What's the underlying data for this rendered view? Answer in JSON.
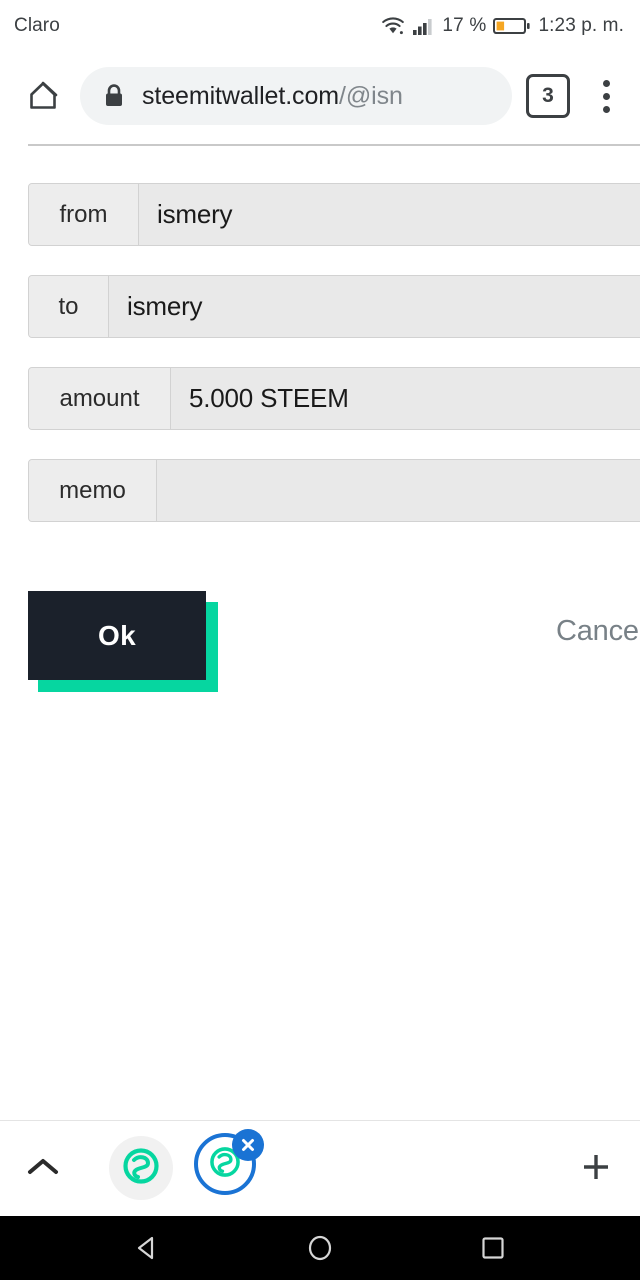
{
  "status_bar": {
    "carrier": "Claro",
    "battery_percent": "17 %",
    "time": "1:23 p. m.",
    "icons": {
      "wifi": "wifi-icon",
      "signal": "cellular-signal-icon",
      "battery": "battery-low-icon"
    },
    "battery_fill_color": "#f5a623",
    "text_color": "#3c4043"
  },
  "browser": {
    "home_icon": "home-icon",
    "lock_icon": "lock-icon",
    "url_domain": "steemitwallet.com",
    "url_path": "/@isn",
    "tab_count": "3",
    "overflow_icon": "more-vertical-icon",
    "url_pill_color": "#f1f3f4"
  },
  "form": {
    "rows": [
      {
        "label": "from",
        "value": "ismery",
        "label_width": 110
      },
      {
        "label": "to",
        "value": "ismery",
        "label_width": 80
      },
      {
        "label": "amount",
        "value": "5.000 STEEM",
        "label_width": 142
      },
      {
        "label": "memo",
        "value": "",
        "label_width": 128
      }
    ],
    "field_bg": "#e9e9e9",
    "label_bg": "#ededed",
    "border_color": "#d2d2d2"
  },
  "actions": {
    "ok_label": "Ok",
    "cancel_label": "Cancel",
    "ok_bg": "#1b212b",
    "ok_shadow": "#06d6a0",
    "cancel_color": "#788187"
  },
  "bottom_bar": {
    "chevron_icon": "chevron-up-icon",
    "app_icon_1": "steem-logo-icon",
    "app_icon_2": "steem-logo-icon",
    "close_badge_icon": "close-icon",
    "plus_icon": "plus-icon",
    "accent_blue": "#1a73d4",
    "steem_green": "#06d6a0"
  },
  "nav_bar": {
    "back_icon": "back-triangle-icon",
    "home_icon": "home-circle-icon",
    "recents_icon": "recents-square-icon"
  }
}
